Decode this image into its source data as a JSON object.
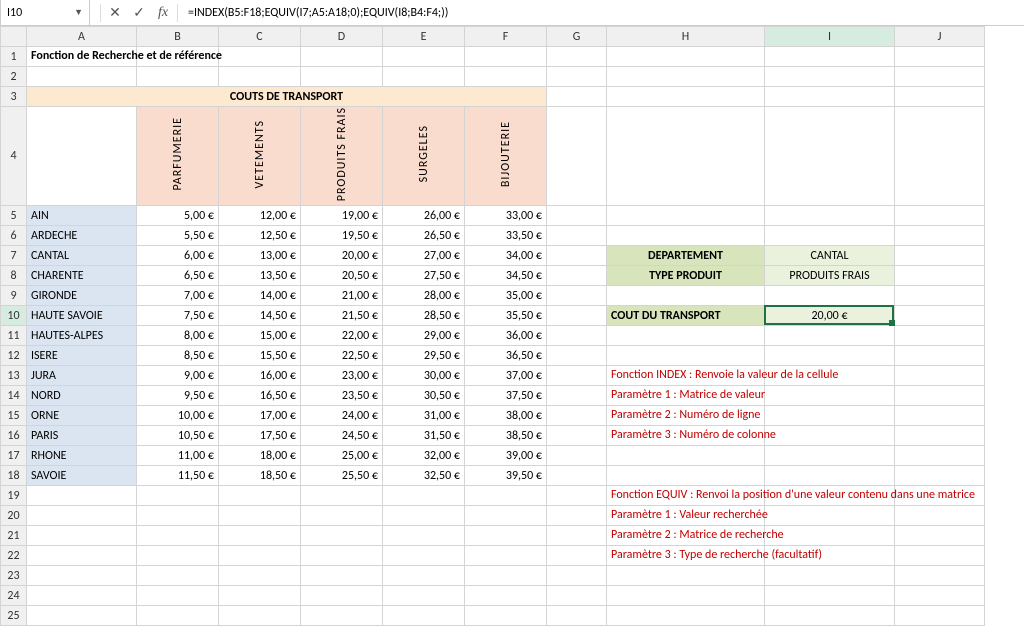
{
  "active_cell": "I10",
  "formula": "=INDEX(B5:F18;EQUIV(I7;A5:A18;0);EQUIV(I8;B4:F4;))",
  "columns": [
    "A",
    "B",
    "C",
    "D",
    "E",
    "F",
    "G",
    "H",
    "I",
    "J"
  ],
  "title_row1": "Fonction de Recherche et de référence",
  "table_title": "COUTS DE TRANSPORT",
  "chart_data": {
    "type": "table",
    "title": "COUTS DE TRANSPORT",
    "columns": [
      "PARFUMERIE",
      "VETEMENTS",
      "PRODUITS FRAIS",
      "SURGELES",
      "BIJOUTERIE"
    ],
    "rows": [
      "AIN",
      "ARDECHE",
      "CANTAL",
      "CHARENTE",
      "GIRONDE",
      "HAUTE SAVOIE",
      "HAUTES-ALPES",
      "ISERE",
      "JURA",
      "NORD",
      "ORNE",
      "PARIS",
      "RHONE",
      "SAVOIE"
    ],
    "values": [
      [
        "5,00 €",
        "12,00 €",
        "19,00 €",
        "26,00 €",
        "33,00 €"
      ],
      [
        "5,50 €",
        "12,50 €",
        "19,50 €",
        "26,50 €",
        "33,50 €"
      ],
      [
        "6,00 €",
        "13,00 €",
        "20,00 €",
        "27,00 €",
        "34,00 €"
      ],
      [
        "6,50 €",
        "13,50 €",
        "20,50 €",
        "27,50 €",
        "34,50 €"
      ],
      [
        "7,00 €",
        "14,00 €",
        "21,00 €",
        "28,00 €",
        "35,00 €"
      ],
      [
        "7,50 €",
        "14,50 €",
        "21,50 €",
        "28,50 €",
        "35,50 €"
      ],
      [
        "8,00 €",
        "15,00 €",
        "22,00 €",
        "29,00 €",
        "36,00 €"
      ],
      [
        "8,50 €",
        "15,50 €",
        "22,50 €",
        "29,50 €",
        "36,50 €"
      ],
      [
        "9,00 €",
        "16,00 €",
        "23,00 €",
        "30,00 €",
        "37,00 €"
      ],
      [
        "9,50 €",
        "16,50 €",
        "23,50 €",
        "30,50 €",
        "37,50 €"
      ],
      [
        "10,00 €",
        "17,00 €",
        "24,00 €",
        "31,00 €",
        "38,00 €"
      ],
      [
        "10,50 €",
        "17,50 €",
        "24,50 €",
        "31,50 €",
        "38,50 €"
      ],
      [
        "11,00 €",
        "18,00 €",
        "25,00 €",
        "32,00 €",
        "39,00 €"
      ],
      [
        "11,50 €",
        "18,50 €",
        "25,50 €",
        "32,50 €",
        "39,50 €"
      ]
    ]
  },
  "lookup": {
    "label_dept": "DEPARTEMENT",
    "val_dept": "CANTAL",
    "label_prod": "TYPE PRODUIT",
    "val_prod": "PRODUITS FRAIS",
    "label_result": "COUT DU TRANSPORT",
    "val_result": "20,00 €"
  },
  "notes_index": [
    "Fonction INDEX : Renvoie la valeur de la cellule",
    "Paramètre 1 : Matrice de valeur",
    "Paramètre 2 : Numéro de ligne",
    "Paramètre 3 : Numéro de colonne"
  ],
  "notes_equiv": [
    "Fonction EQUIV : Renvoi la position d'une valeur contenu dans une matrice",
    "Paramètre 1 : Valeur recherchée",
    "Paramètre 2 : Matrice de recherche",
    "Paramètre 3 : Type de recherche (facultatif)"
  ]
}
